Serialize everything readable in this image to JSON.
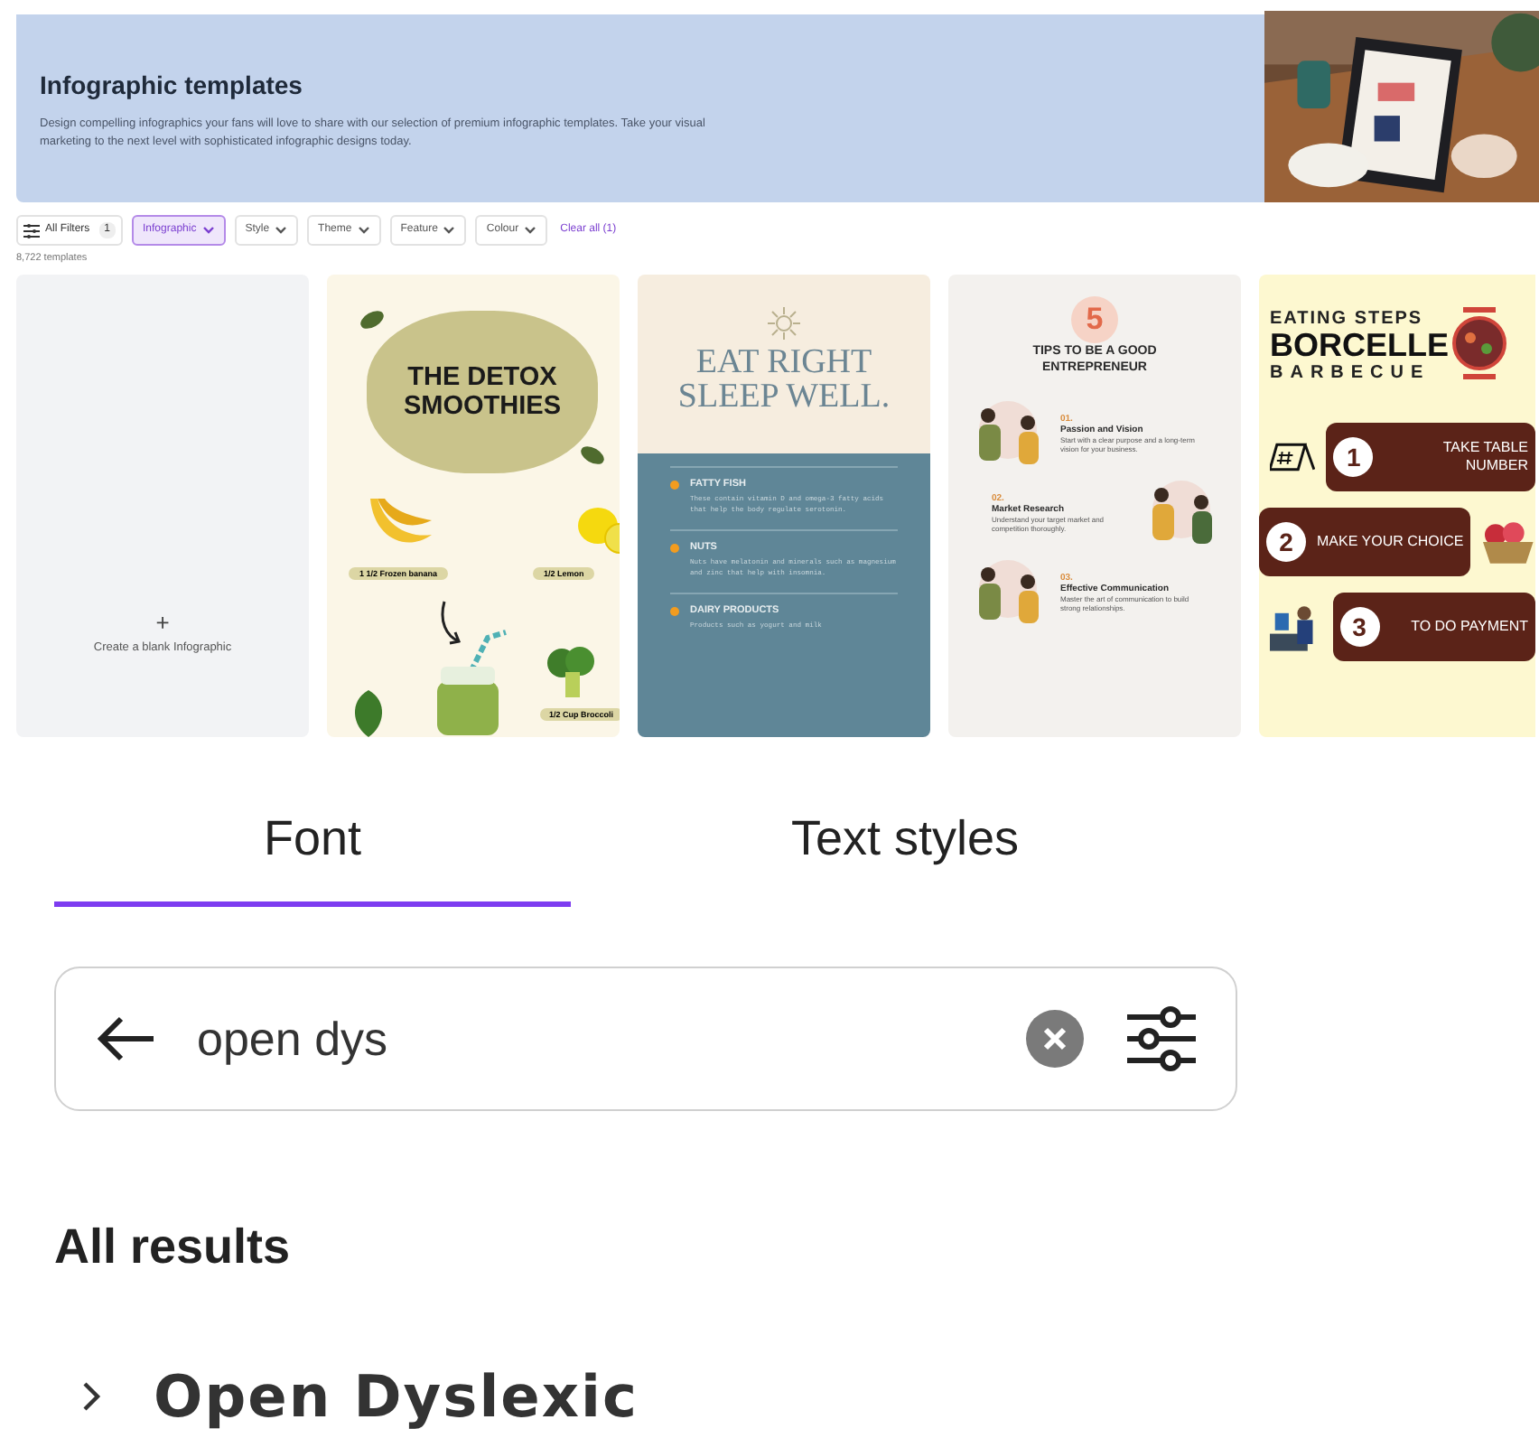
{
  "banner": {
    "title": "Infographic templates",
    "description": "Design compelling infographics your fans will love to share with our selection of premium infographic templates. Take your visual marketing to the next level with sophisticated infographic designs today."
  },
  "filters": {
    "all_filters": {
      "label": "All Filters",
      "count": "1"
    },
    "chips": [
      {
        "label": "Infographic",
        "selected": true
      },
      {
        "label": "Style",
        "selected": false
      },
      {
        "label": "Theme",
        "selected": false
      },
      {
        "label": "Feature",
        "selected": false
      },
      {
        "label": "Colour",
        "selected": false
      }
    ],
    "clear": "Clear all (1)"
  },
  "result_count": "8,722 templates",
  "templates": [
    {
      "kind": "blank",
      "icon_text": "+",
      "label": "Create a blank Infographic"
    },
    {
      "kind": "detox",
      "title": "THE DETOX SMOOTHIES",
      "labels": [
        "1 1/2 Frozen banana",
        "1/2 Lemon",
        "1/2 Cup Broccoli"
      ]
    },
    {
      "kind": "sleep",
      "title": "EAT RIGHT SLEEP WELL.",
      "items": [
        {
          "name": "FATTY FISH",
          "text": "These contain vitamin D and omega-3 fatty acids that help the body regulate serotonin."
        },
        {
          "name": "NUTS",
          "text": "Nuts have melatonin and minerals such as magnesium and zinc that help with insomnia."
        },
        {
          "name": "DAIRY PRODUCTS",
          "text": "Products such as yogurt and milk"
        }
      ]
    },
    {
      "kind": "tips",
      "number": "5",
      "title": "TIPS TO BE A GOOD ENTREPRENEUR",
      "items": [
        {
          "number": "01.",
          "name": "Passion and Vision",
          "text": "Start with a clear purpose and a long-term vision for your business."
        },
        {
          "number": "02.",
          "name": "Market Research",
          "text": "Understand your target market and competition thoroughly."
        },
        {
          "number": "03.",
          "name": "Effective Communication",
          "text": "Master the art of communication to build strong relationships."
        }
      ]
    },
    {
      "kind": "barbecue",
      "kicker": "EATING STEPS",
      "title": "BORCELLE",
      "subtitle": "BARBECUE",
      "steps": [
        {
          "number": "1",
          "text": "TAKE TABLE NUMBER"
        },
        {
          "number": "2",
          "text": "MAKE YOUR CHOICE"
        },
        {
          "number": "3",
          "text": "TO DO PAYMENT"
        }
      ]
    }
  ],
  "font_panel": {
    "tabs": [
      {
        "label": "Font",
        "selected": true
      },
      {
        "label": "Text styles",
        "selected": false
      }
    ],
    "search": {
      "value": "open dys"
    },
    "section_title": "All results",
    "results": [
      {
        "name": "Open Dyslexic",
        "expanded": false
      }
    ]
  }
}
